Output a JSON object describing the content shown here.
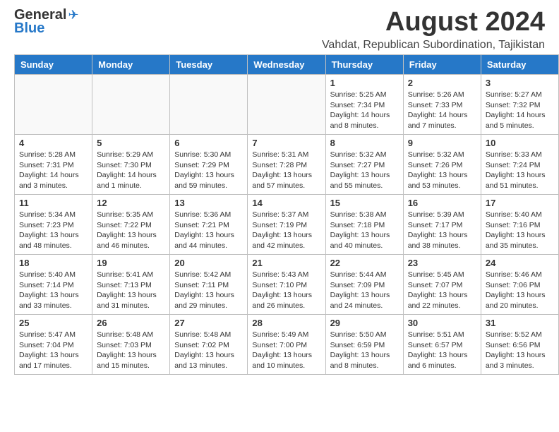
{
  "header": {
    "logo_general": "General",
    "logo_blue": "Blue",
    "month": "August 2024",
    "location": "Vahdat, Republican Subordination, Tajikistan"
  },
  "days_of_week": [
    "Sunday",
    "Monday",
    "Tuesday",
    "Wednesday",
    "Thursday",
    "Friday",
    "Saturday"
  ],
  "weeks": [
    [
      {
        "day": "",
        "info": "",
        "empty": true
      },
      {
        "day": "",
        "info": "",
        "empty": true
      },
      {
        "day": "",
        "info": "",
        "empty": true
      },
      {
        "day": "",
        "info": "",
        "empty": true
      },
      {
        "day": "1",
        "info": "Sunrise: 5:25 AM\nSunset: 7:34 PM\nDaylight: 14 hours\nand 8 minutes."
      },
      {
        "day": "2",
        "info": "Sunrise: 5:26 AM\nSunset: 7:33 PM\nDaylight: 14 hours\nand 7 minutes."
      },
      {
        "day": "3",
        "info": "Sunrise: 5:27 AM\nSunset: 7:32 PM\nDaylight: 14 hours\nand 5 minutes."
      }
    ],
    [
      {
        "day": "4",
        "info": "Sunrise: 5:28 AM\nSunset: 7:31 PM\nDaylight: 14 hours\nand 3 minutes."
      },
      {
        "day": "5",
        "info": "Sunrise: 5:29 AM\nSunset: 7:30 PM\nDaylight: 14 hours\nand 1 minute."
      },
      {
        "day": "6",
        "info": "Sunrise: 5:30 AM\nSunset: 7:29 PM\nDaylight: 13 hours\nand 59 minutes."
      },
      {
        "day": "7",
        "info": "Sunrise: 5:31 AM\nSunset: 7:28 PM\nDaylight: 13 hours\nand 57 minutes."
      },
      {
        "day": "8",
        "info": "Sunrise: 5:32 AM\nSunset: 7:27 PM\nDaylight: 13 hours\nand 55 minutes."
      },
      {
        "day": "9",
        "info": "Sunrise: 5:32 AM\nSunset: 7:26 PM\nDaylight: 13 hours\nand 53 minutes."
      },
      {
        "day": "10",
        "info": "Sunrise: 5:33 AM\nSunset: 7:24 PM\nDaylight: 13 hours\nand 51 minutes."
      }
    ],
    [
      {
        "day": "11",
        "info": "Sunrise: 5:34 AM\nSunset: 7:23 PM\nDaylight: 13 hours\nand 48 minutes."
      },
      {
        "day": "12",
        "info": "Sunrise: 5:35 AM\nSunset: 7:22 PM\nDaylight: 13 hours\nand 46 minutes."
      },
      {
        "day": "13",
        "info": "Sunrise: 5:36 AM\nSunset: 7:21 PM\nDaylight: 13 hours\nand 44 minutes."
      },
      {
        "day": "14",
        "info": "Sunrise: 5:37 AM\nSunset: 7:19 PM\nDaylight: 13 hours\nand 42 minutes."
      },
      {
        "day": "15",
        "info": "Sunrise: 5:38 AM\nSunset: 7:18 PM\nDaylight: 13 hours\nand 40 minutes."
      },
      {
        "day": "16",
        "info": "Sunrise: 5:39 AM\nSunset: 7:17 PM\nDaylight: 13 hours\nand 38 minutes."
      },
      {
        "day": "17",
        "info": "Sunrise: 5:40 AM\nSunset: 7:16 PM\nDaylight: 13 hours\nand 35 minutes."
      }
    ],
    [
      {
        "day": "18",
        "info": "Sunrise: 5:40 AM\nSunset: 7:14 PM\nDaylight: 13 hours\nand 33 minutes."
      },
      {
        "day": "19",
        "info": "Sunrise: 5:41 AM\nSunset: 7:13 PM\nDaylight: 13 hours\nand 31 minutes."
      },
      {
        "day": "20",
        "info": "Sunrise: 5:42 AM\nSunset: 7:11 PM\nDaylight: 13 hours\nand 29 minutes."
      },
      {
        "day": "21",
        "info": "Sunrise: 5:43 AM\nSunset: 7:10 PM\nDaylight: 13 hours\nand 26 minutes."
      },
      {
        "day": "22",
        "info": "Sunrise: 5:44 AM\nSunset: 7:09 PM\nDaylight: 13 hours\nand 24 minutes."
      },
      {
        "day": "23",
        "info": "Sunrise: 5:45 AM\nSunset: 7:07 PM\nDaylight: 13 hours\nand 22 minutes."
      },
      {
        "day": "24",
        "info": "Sunrise: 5:46 AM\nSunset: 7:06 PM\nDaylight: 13 hours\nand 20 minutes."
      }
    ],
    [
      {
        "day": "25",
        "info": "Sunrise: 5:47 AM\nSunset: 7:04 PM\nDaylight: 13 hours\nand 17 minutes."
      },
      {
        "day": "26",
        "info": "Sunrise: 5:48 AM\nSunset: 7:03 PM\nDaylight: 13 hours\nand 15 minutes."
      },
      {
        "day": "27",
        "info": "Sunrise: 5:48 AM\nSunset: 7:02 PM\nDaylight: 13 hours\nand 13 minutes."
      },
      {
        "day": "28",
        "info": "Sunrise: 5:49 AM\nSunset: 7:00 PM\nDaylight: 13 hours\nand 10 minutes."
      },
      {
        "day": "29",
        "info": "Sunrise: 5:50 AM\nSunset: 6:59 PM\nDaylight: 13 hours\nand 8 minutes."
      },
      {
        "day": "30",
        "info": "Sunrise: 5:51 AM\nSunset: 6:57 PM\nDaylight: 13 hours\nand 6 minutes."
      },
      {
        "day": "31",
        "info": "Sunrise: 5:52 AM\nSunset: 6:56 PM\nDaylight: 13 hours\nand 3 minutes."
      }
    ]
  ]
}
